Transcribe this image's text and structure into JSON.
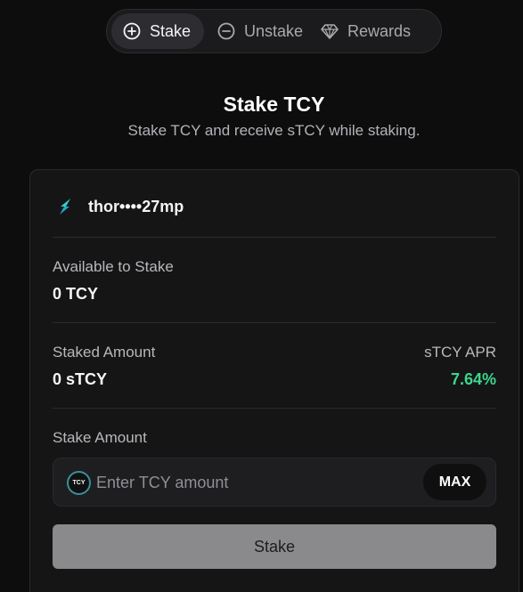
{
  "tabs": [
    {
      "label": "Stake",
      "icon": "plus-circle-icon",
      "active": true
    },
    {
      "label": "Unstake",
      "icon": "minus-circle-icon",
      "active": false
    },
    {
      "label": "Rewards",
      "icon": "diamond-icon",
      "active": false
    }
  ],
  "header": {
    "title": "Stake TCY",
    "subtitle": "Stake TCY and receive sTCY while staking."
  },
  "wallet": {
    "address": "thor••••27mp",
    "icon": "thorchain-logo-icon"
  },
  "available": {
    "label": "Available to Stake",
    "value": "0 TCY"
  },
  "staked": {
    "label": "Staked Amount",
    "value": "0 sTCY",
    "apr_label": "sTCY APR",
    "apr_value": "7.64%"
  },
  "stake_amount": {
    "label": "Stake Amount",
    "placeholder": "Enter TCY amount",
    "coin_label": "TCY",
    "max_label": "MAX"
  },
  "actions": {
    "stake_label": "Stake"
  },
  "colors": {
    "background": "#0d0d0e",
    "card": "#151516",
    "accent_green": "#3dd68c",
    "button_disabled": "#8a8a8c"
  }
}
